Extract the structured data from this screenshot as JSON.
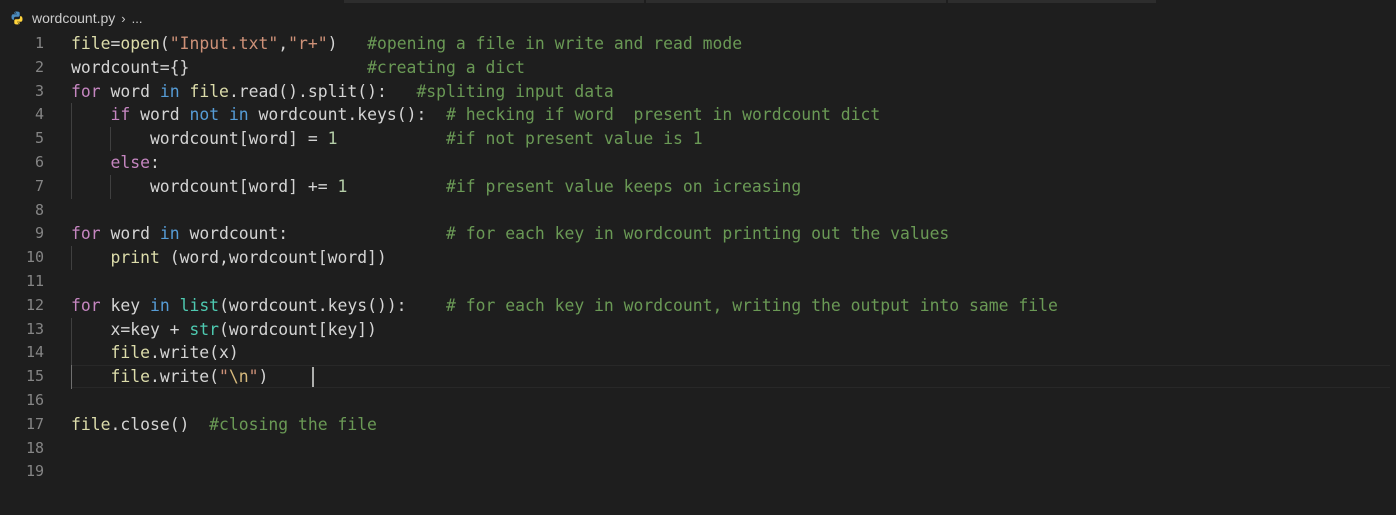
{
  "breadcrumb": {
    "file_name": "wordcount.py",
    "separator": "›",
    "more": "..."
  },
  "icons": {
    "file_icon": "python-icon",
    "separator_icon": "chevron-right-icon"
  },
  "colors": {
    "background": "#1e1e1e",
    "line_number": "#858585",
    "keyword_control": "#c586c0",
    "keyword": "#569cd6",
    "function": "#dcdcaa",
    "string": "#ce9178",
    "number": "#b5cea8",
    "comment": "#6a9955",
    "text": "#d4d4d4"
  },
  "editor": {
    "cursor_line": 15,
    "lines": [
      {
        "number": "1",
        "indent": 0,
        "tokens": [
          {
            "t": "file",
            "c": "fn"
          },
          {
            "t": "=",
            "c": "plain"
          },
          {
            "t": "open",
            "c": "fn"
          },
          {
            "t": "(",
            "c": "plain"
          },
          {
            "t": "\"Input.txt\"",
            "c": "str"
          },
          {
            "t": ",",
            "c": "plain"
          },
          {
            "t": "\"r+\"",
            "c": "str"
          },
          {
            "t": ")   ",
            "c": "plain"
          },
          {
            "t": "#opening a file in write and read mode",
            "c": "com"
          }
        ]
      },
      {
        "number": "2",
        "indent": 0,
        "tokens": [
          {
            "t": "wordcount={}",
            "c": "plain"
          },
          {
            "t": "                  ",
            "c": "plain"
          },
          {
            "t": "#creating a dict",
            "c": "com"
          }
        ]
      },
      {
        "number": "3",
        "indent": 0,
        "tokens": [
          {
            "t": "for",
            "c": "kw-ctrl"
          },
          {
            "t": " word ",
            "c": "plain"
          },
          {
            "t": "in",
            "c": "kw"
          },
          {
            "t": " ",
            "c": "plain"
          },
          {
            "t": "file",
            "c": "fn"
          },
          {
            "t": ".read().split():   ",
            "c": "plain"
          },
          {
            "t": "#spliting input data",
            "c": "com"
          }
        ]
      },
      {
        "number": "4",
        "indent": 1,
        "tokens": [
          {
            "t": "    ",
            "c": "plain"
          },
          {
            "t": "if",
            "c": "kw-ctrl"
          },
          {
            "t": " word ",
            "c": "plain"
          },
          {
            "t": "not",
            "c": "kw"
          },
          {
            "t": " ",
            "c": "plain"
          },
          {
            "t": "in",
            "c": "kw"
          },
          {
            "t": " wordcount.keys():  ",
            "c": "plain"
          },
          {
            "t": "# hecking if word  present in wordcount dict",
            "c": "com"
          }
        ]
      },
      {
        "number": "5",
        "indent": 2,
        "tokens": [
          {
            "t": "        wordcount[word] = ",
            "c": "plain"
          },
          {
            "t": "1",
            "c": "num"
          },
          {
            "t": "           ",
            "c": "plain"
          },
          {
            "t": "#if not present value is 1",
            "c": "com"
          }
        ]
      },
      {
        "number": "6",
        "indent": 1,
        "tokens": [
          {
            "t": "    ",
            "c": "plain"
          },
          {
            "t": "else",
            "c": "kw-ctrl"
          },
          {
            "t": ":",
            "c": "plain"
          }
        ]
      },
      {
        "number": "7",
        "indent": 2,
        "tokens": [
          {
            "t": "        wordcount[word] += ",
            "c": "plain"
          },
          {
            "t": "1",
            "c": "num"
          },
          {
            "t": "          ",
            "c": "plain"
          },
          {
            "t": "#if present value keeps on icreasing",
            "c": "com"
          }
        ]
      },
      {
        "number": "8",
        "indent": 0,
        "tokens": []
      },
      {
        "number": "9",
        "indent": 0,
        "tokens": [
          {
            "t": "for",
            "c": "kw-ctrl"
          },
          {
            "t": " word ",
            "c": "plain"
          },
          {
            "t": "in",
            "c": "kw"
          },
          {
            "t": " wordcount:",
            "c": "plain"
          },
          {
            "t": "                ",
            "c": "plain"
          },
          {
            "t": "# for each key in wordcount printing out the values",
            "c": "com"
          }
        ]
      },
      {
        "number": "10",
        "indent": 1,
        "tokens": [
          {
            "t": "    ",
            "c": "plain"
          },
          {
            "t": "print",
            "c": "fn"
          },
          {
            "t": " (word,wordcount[word])",
            "c": "plain"
          }
        ]
      },
      {
        "number": "11",
        "indent": 0,
        "tokens": []
      },
      {
        "number": "12",
        "indent": 0,
        "tokens": [
          {
            "t": "for",
            "c": "kw-ctrl"
          },
          {
            "t": " key ",
            "c": "plain"
          },
          {
            "t": "in",
            "c": "kw"
          },
          {
            "t": " ",
            "c": "plain"
          },
          {
            "t": "list",
            "c": "bi"
          },
          {
            "t": "(wordcount.keys()):    ",
            "c": "plain"
          },
          {
            "t": "# for each key in wordcount, writing the output into same file",
            "c": "com"
          }
        ]
      },
      {
        "number": "13",
        "indent": 1,
        "tokens": [
          {
            "t": "    x=key + ",
            "c": "plain"
          },
          {
            "t": "str",
            "c": "bi"
          },
          {
            "t": "(wordcount[key])",
            "c": "plain"
          }
        ]
      },
      {
        "number": "14",
        "indent": 1,
        "tokens": [
          {
            "t": "    ",
            "c": "plain"
          },
          {
            "t": "file",
            "c": "fn"
          },
          {
            "t": ".write(x)",
            "c": "plain"
          }
        ]
      },
      {
        "number": "15",
        "indent": 1,
        "tokens": [
          {
            "t": "    ",
            "c": "plain"
          },
          {
            "t": "file",
            "c": "fn"
          },
          {
            "t": ".write(",
            "c": "plain"
          },
          {
            "t": "\"",
            "c": "str"
          },
          {
            "t": "\\n",
            "c": "esc"
          },
          {
            "t": "\"",
            "c": "str"
          },
          {
            "t": ")",
            "c": "plain"
          }
        ]
      },
      {
        "number": "16",
        "indent": 0,
        "tokens": []
      },
      {
        "number": "17",
        "indent": 0,
        "tokens": [
          {
            "t": "file",
            "c": "fn"
          },
          {
            "t": ".close()  ",
            "c": "plain"
          },
          {
            "t": "#closing the file",
            "c": "com"
          }
        ]
      },
      {
        "number": "18",
        "indent": 0,
        "tokens": []
      },
      {
        "number": "19",
        "indent": 0,
        "tokens": []
      }
    ]
  }
}
